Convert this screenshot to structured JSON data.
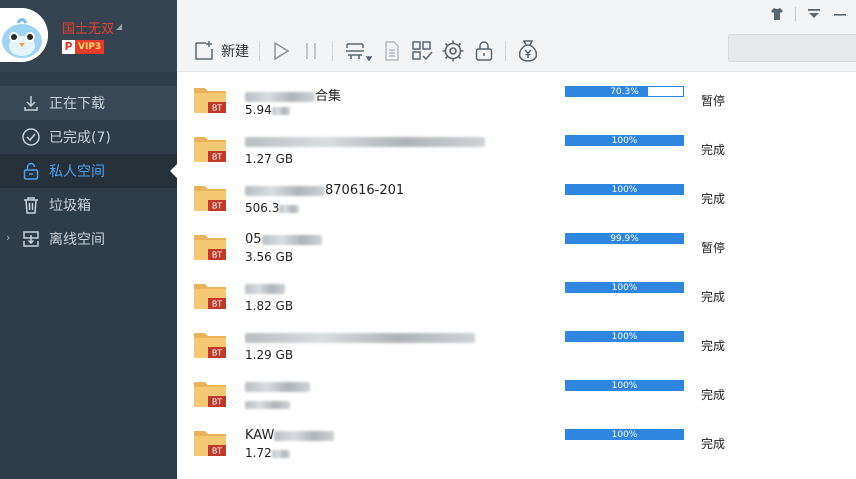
{
  "user": {
    "name": "国士无双",
    "vip_label": "VIP3",
    "vip_badge_letter": "P"
  },
  "nav": {
    "items": [
      {
        "label": "正在下载",
        "icon": "download-icon",
        "state": "normal"
      },
      {
        "label": "已完成(7)",
        "icon": "check-circle-icon",
        "state": "normal"
      },
      {
        "label": "私人空间",
        "icon": "lock-icon",
        "state": "active"
      },
      {
        "label": "垃圾箱",
        "icon": "trash-icon",
        "state": "normal"
      },
      {
        "label": "离线空间",
        "icon": "cloud-download-icon",
        "state": "normal"
      }
    ]
  },
  "toolbar": {
    "new_label": "新建"
  },
  "tasks": [
    {
      "name_suffix": "合集",
      "size": "5.94",
      "progress": 70.3,
      "progress_text": "70.3%",
      "status": "暂停"
    },
    {
      "name_suffix": "",
      "size": "1.27 GB",
      "progress": 100,
      "progress_text": "100%",
      "status": "完成"
    },
    {
      "name_suffix": "870616-201",
      "size": "506.3",
      "progress": 100,
      "progress_text": "100%",
      "status": "完成"
    },
    {
      "name_suffix": "05",
      "size": "3.56 GB",
      "progress": 99.9,
      "progress_text": "99.9%",
      "status": "暂停"
    },
    {
      "name_suffix": "",
      "size": "1.82 GB",
      "progress": 100,
      "progress_text": "100%",
      "status": "完成"
    },
    {
      "name_suffix": "",
      "size": "1.29 GB",
      "progress": 100,
      "progress_text": "100%",
      "status": "完成"
    },
    {
      "name_suffix": "",
      "size": "",
      "progress": 100,
      "progress_text": "100%",
      "status": "完成"
    },
    {
      "name_suffix": "KAW",
      "size": "1.72",
      "progress": 100,
      "progress_text": "100%",
      "status": "完成"
    }
  ],
  "file_type_badge": "BT",
  "colors": {
    "sidebar_bg": "#2f3d48",
    "accent_blue": "#2f86e0",
    "username_red": "#e8402f",
    "folder": "#f5c873"
  }
}
